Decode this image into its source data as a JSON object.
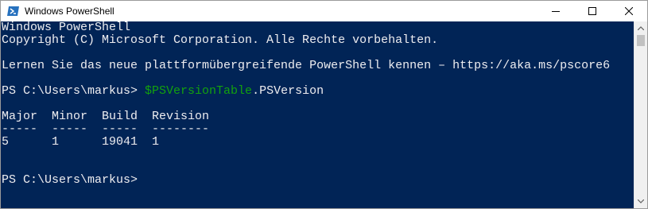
{
  "window": {
    "title": "Windows PowerShell",
    "icon": "powershell-icon",
    "controls": [
      "minimize-icon",
      "maximize-icon",
      "close-icon"
    ]
  },
  "console": {
    "header_line": "Windows PowerShell",
    "copyright_line": "Copyright (C) Microsoft Corporation. Alle Rechte vorbehalten.",
    "info_line": "Lernen Sie das neue plattformübergreifende PowerShell kennen – https://aka.ms/pscore6",
    "prompt1": "PS C:\\Users\\markus> ",
    "command_variable": "$PSVersionTable",
    "command_property": ".PSVersion",
    "table_header": "Major  Minor  Build  Revision",
    "table_separator": "-----  -----  -----  --------",
    "table_row": "5      1      19041  1",
    "prompt2": "PS C:\\Users\\markus>"
  },
  "colors": {
    "background": "#012456",
    "foreground": "#eeedf0",
    "variable": "#13a10e"
  }
}
